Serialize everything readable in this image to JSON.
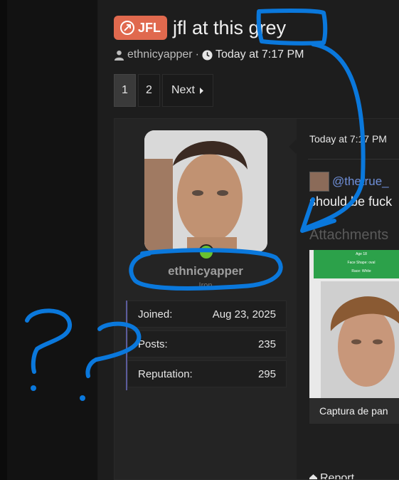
{
  "thread": {
    "prefix": "JFL",
    "title": "jfl at this grey",
    "author": "ethnicyapper",
    "separator": "·",
    "time": "Today at 7:17 PM"
  },
  "pagination": {
    "pages": [
      "1",
      "2"
    ],
    "current": "1",
    "next_label": "Next"
  },
  "post": {
    "username": "ethnicyapper",
    "user_title": "Iron",
    "stats": [
      {
        "label": "Joined:",
        "value": "Aug 23, 2025"
      },
      {
        "label": "Posts:",
        "value": "235"
      },
      {
        "label": "Reputation:",
        "value": "295"
      }
    ],
    "date": "Today at 7:17 PM",
    "mention": "@thetrue_",
    "body": "should be fuck",
    "attachments_heading": "Attachments",
    "attachment": {
      "lines": [
        "Age 18",
        "Face Shape: oval",
        "Race: White"
      ],
      "caption": "Captura de pan"
    },
    "report_label": "Report"
  },
  "colors": {
    "prefix_bg": "#e0694e",
    "mention": "#6f8fd8",
    "online": "#6ac12f",
    "annotation_ink": "#0a78dc"
  }
}
